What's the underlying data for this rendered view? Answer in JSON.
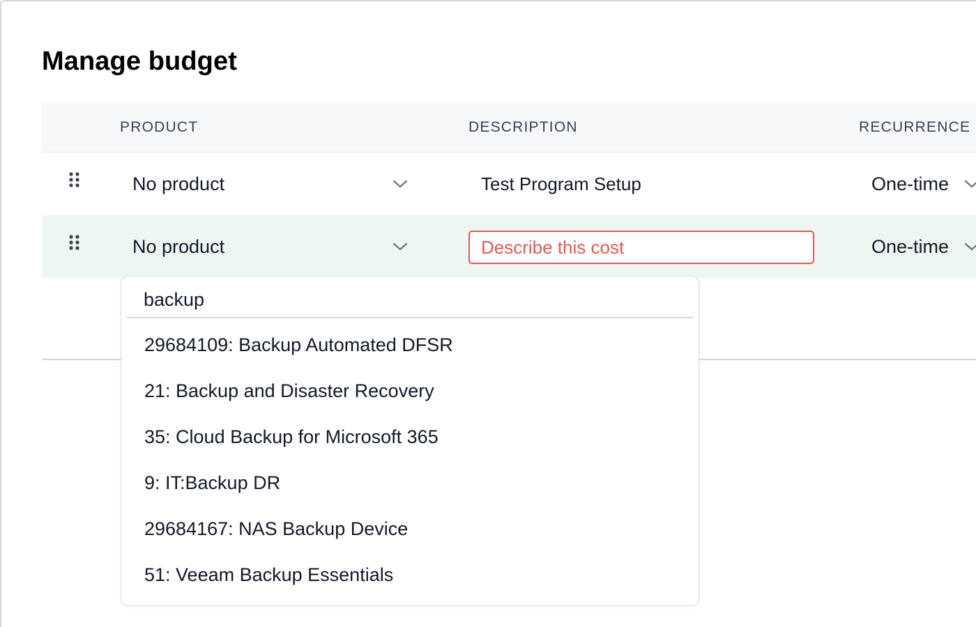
{
  "page": {
    "title": "Manage budget"
  },
  "table": {
    "columns": {
      "product": "PRODUCT",
      "description": "DESCRIPTION",
      "recurrence": "RECURRENCE"
    },
    "rows": [
      {
        "product": "No product",
        "description": "Test Program Setup",
        "recurrence": "One-time"
      },
      {
        "product": "No product",
        "description_value": "",
        "description_placeholder": "Describe this cost",
        "recurrence": "One-time"
      }
    ]
  },
  "product_dropdown": {
    "search_value": "backup",
    "options": [
      "29684109: Backup Automated DFSR",
      "21: Backup and Disaster Recovery",
      "35: Cloud Backup for Microsoft 365",
      "9: IT:Backup DR",
      "29684167: NAS Backup Device",
      "51: Veeam Backup Essentials"
    ]
  },
  "colors": {
    "header_bg": "#f7f8fa",
    "active_row_bg": "#eef6f1",
    "error": "#e05a52",
    "border": "#d1d5db"
  },
  "icons": {
    "drag_handle": "drag-handle-icon",
    "select_arrow": "chevron-down-icon"
  }
}
